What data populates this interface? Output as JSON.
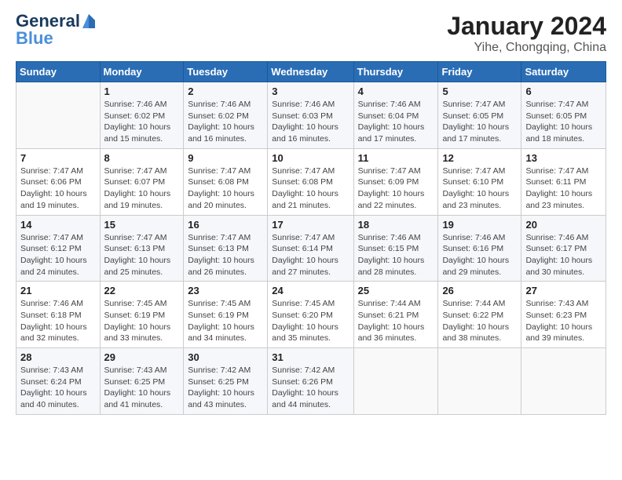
{
  "logo": {
    "line1": "General",
    "line2": "Blue"
  },
  "title": "January 2024",
  "subtitle": "Yihe, Chongqing, China",
  "weekdays": [
    "Sunday",
    "Monday",
    "Tuesday",
    "Wednesday",
    "Thursday",
    "Friday",
    "Saturday"
  ],
  "weeks": [
    [
      {
        "day": "",
        "info": ""
      },
      {
        "day": "1",
        "info": "Sunrise: 7:46 AM\nSunset: 6:02 PM\nDaylight: 10 hours\nand 15 minutes."
      },
      {
        "day": "2",
        "info": "Sunrise: 7:46 AM\nSunset: 6:02 PM\nDaylight: 10 hours\nand 16 minutes."
      },
      {
        "day": "3",
        "info": "Sunrise: 7:46 AM\nSunset: 6:03 PM\nDaylight: 10 hours\nand 16 minutes."
      },
      {
        "day": "4",
        "info": "Sunrise: 7:46 AM\nSunset: 6:04 PM\nDaylight: 10 hours\nand 17 minutes."
      },
      {
        "day": "5",
        "info": "Sunrise: 7:47 AM\nSunset: 6:05 PM\nDaylight: 10 hours\nand 17 minutes."
      },
      {
        "day": "6",
        "info": "Sunrise: 7:47 AM\nSunset: 6:05 PM\nDaylight: 10 hours\nand 18 minutes."
      }
    ],
    [
      {
        "day": "7",
        "info": "Sunrise: 7:47 AM\nSunset: 6:06 PM\nDaylight: 10 hours\nand 19 minutes."
      },
      {
        "day": "8",
        "info": "Sunrise: 7:47 AM\nSunset: 6:07 PM\nDaylight: 10 hours\nand 19 minutes."
      },
      {
        "day": "9",
        "info": "Sunrise: 7:47 AM\nSunset: 6:08 PM\nDaylight: 10 hours\nand 20 minutes."
      },
      {
        "day": "10",
        "info": "Sunrise: 7:47 AM\nSunset: 6:08 PM\nDaylight: 10 hours\nand 21 minutes."
      },
      {
        "day": "11",
        "info": "Sunrise: 7:47 AM\nSunset: 6:09 PM\nDaylight: 10 hours\nand 22 minutes."
      },
      {
        "day": "12",
        "info": "Sunrise: 7:47 AM\nSunset: 6:10 PM\nDaylight: 10 hours\nand 23 minutes."
      },
      {
        "day": "13",
        "info": "Sunrise: 7:47 AM\nSunset: 6:11 PM\nDaylight: 10 hours\nand 23 minutes."
      }
    ],
    [
      {
        "day": "14",
        "info": "Sunrise: 7:47 AM\nSunset: 6:12 PM\nDaylight: 10 hours\nand 24 minutes."
      },
      {
        "day": "15",
        "info": "Sunrise: 7:47 AM\nSunset: 6:13 PM\nDaylight: 10 hours\nand 25 minutes."
      },
      {
        "day": "16",
        "info": "Sunrise: 7:47 AM\nSunset: 6:13 PM\nDaylight: 10 hours\nand 26 minutes."
      },
      {
        "day": "17",
        "info": "Sunrise: 7:47 AM\nSunset: 6:14 PM\nDaylight: 10 hours\nand 27 minutes."
      },
      {
        "day": "18",
        "info": "Sunrise: 7:46 AM\nSunset: 6:15 PM\nDaylight: 10 hours\nand 28 minutes."
      },
      {
        "day": "19",
        "info": "Sunrise: 7:46 AM\nSunset: 6:16 PM\nDaylight: 10 hours\nand 29 minutes."
      },
      {
        "day": "20",
        "info": "Sunrise: 7:46 AM\nSunset: 6:17 PM\nDaylight: 10 hours\nand 30 minutes."
      }
    ],
    [
      {
        "day": "21",
        "info": "Sunrise: 7:46 AM\nSunset: 6:18 PM\nDaylight: 10 hours\nand 32 minutes."
      },
      {
        "day": "22",
        "info": "Sunrise: 7:45 AM\nSunset: 6:19 PM\nDaylight: 10 hours\nand 33 minutes."
      },
      {
        "day": "23",
        "info": "Sunrise: 7:45 AM\nSunset: 6:19 PM\nDaylight: 10 hours\nand 34 minutes."
      },
      {
        "day": "24",
        "info": "Sunrise: 7:45 AM\nSunset: 6:20 PM\nDaylight: 10 hours\nand 35 minutes."
      },
      {
        "day": "25",
        "info": "Sunrise: 7:44 AM\nSunset: 6:21 PM\nDaylight: 10 hours\nand 36 minutes."
      },
      {
        "day": "26",
        "info": "Sunrise: 7:44 AM\nSunset: 6:22 PM\nDaylight: 10 hours\nand 38 minutes."
      },
      {
        "day": "27",
        "info": "Sunrise: 7:43 AM\nSunset: 6:23 PM\nDaylight: 10 hours\nand 39 minutes."
      }
    ],
    [
      {
        "day": "28",
        "info": "Sunrise: 7:43 AM\nSunset: 6:24 PM\nDaylight: 10 hours\nand 40 minutes."
      },
      {
        "day": "29",
        "info": "Sunrise: 7:43 AM\nSunset: 6:25 PM\nDaylight: 10 hours\nand 41 minutes."
      },
      {
        "day": "30",
        "info": "Sunrise: 7:42 AM\nSunset: 6:25 PM\nDaylight: 10 hours\nand 43 minutes."
      },
      {
        "day": "31",
        "info": "Sunrise: 7:42 AM\nSunset: 6:26 PM\nDaylight: 10 hours\nand 44 minutes."
      },
      {
        "day": "",
        "info": ""
      },
      {
        "day": "",
        "info": ""
      },
      {
        "day": "",
        "info": ""
      }
    ]
  ]
}
